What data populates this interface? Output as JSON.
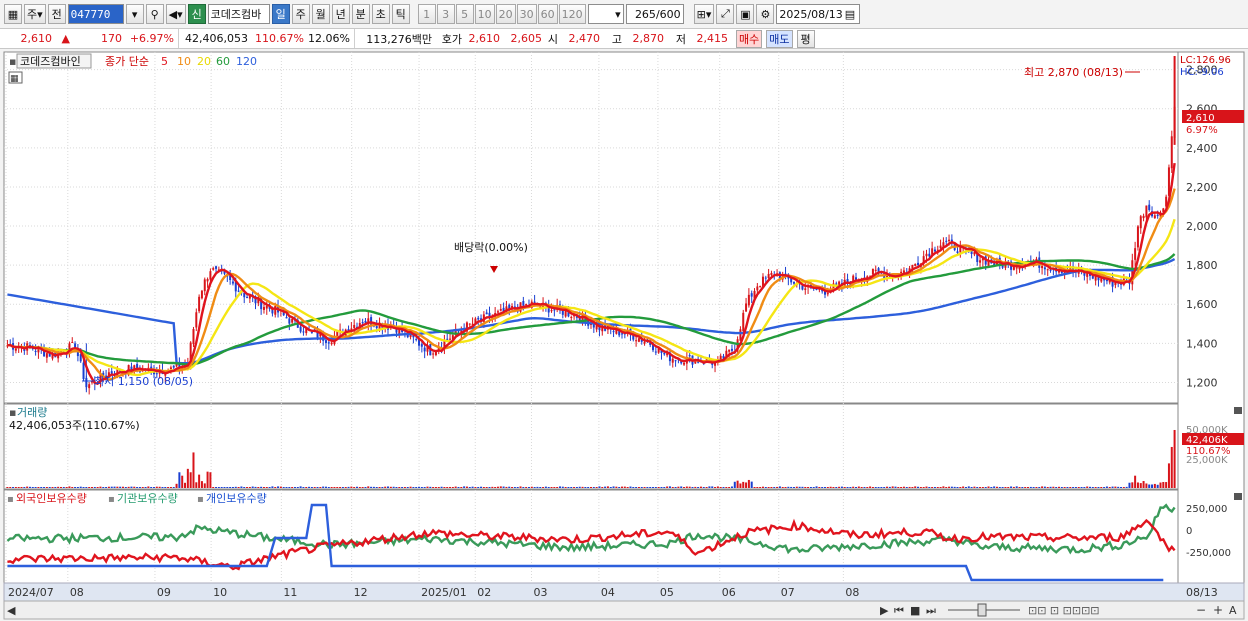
{
  "toolbar": {
    "market": "주",
    "prev": "전",
    "code": "047770",
    "badge": "신",
    "name": "코데즈컴바",
    "periods": [
      "일",
      "주",
      "월",
      "년",
      "분",
      "초",
      "틱"
    ],
    "intervals": [
      "1",
      "3",
      "5",
      "10",
      "20",
      "30",
      "60",
      "120"
    ],
    "count": "265",
    "count_total": "/600",
    "date": "2025/08/13"
  },
  "quote": {
    "price": "2,610",
    "arrow": "▲",
    "change": "170",
    "change_pct": "+6.97%",
    "volume": "42,406,053",
    "volume_ratio": "110.67%",
    "turnover": "12.06%",
    "amount": "113,276백만",
    "ask_label": "호가",
    "ask1": "2,610",
    "ask2": "2,605",
    "open_label": "시",
    "open": "2,470",
    "high_label": "고",
    "high": "2,870",
    "low_label": "저",
    "low": "2,415",
    "buy_label": "매수",
    "sell_label": "매도",
    "avg_label": "평"
  },
  "legend": {
    "stock": "코데즈컴바인",
    "ma_label": "종가 단순",
    "ma5": "5",
    "ma10": "10",
    "ma20": "20",
    "ma60": "60",
    "ma120": "120"
  },
  "annotations": {
    "high": "최고 2,870 (08/13)",
    "low": "최저 1,150 (08/05)",
    "dividend": "배당락(0.00%)",
    "lc": "LC:126.96",
    "hc": "HC:-9.06",
    "last_price": "2,610",
    "last_pct": "6.97%",
    "vol_title": "거래량",
    "vol_value": "42,406,053주(110.67%)",
    "vol_last": "42,406K",
    "vol_pct": "110.67%",
    "holders": [
      "외국인보유수량",
      "기관보유수량",
      "개인보유수량"
    ]
  },
  "x_labels": [
    "2024/07",
    "08",
    "09",
    "10",
    "11",
    "12",
    "2025/01",
    "02",
    "03",
    "04",
    "05",
    "06",
    "07",
    "08",
    "08/13"
  ],
  "y_labels": [
    "2,800",
    "2,600",
    "2,400",
    "2,200",
    "2,000",
    "1,800",
    "1,600",
    "1,400",
    "1,200"
  ],
  "vol_y_labels": [
    "50,000K",
    "25,000K"
  ],
  "hold_y_labels": [
    "250,000",
    "0",
    "-250,000"
  ],
  "colors": {
    "ma5": "#e0141e",
    "ma10": "#f08c14",
    "ma20": "#f5e614",
    "ma60": "#239b3c",
    "ma120": "#2d5fdc",
    "up": "#d8141a",
    "down": "#1a3fd1"
  },
  "chart_data": {
    "type": "candlestick",
    "title": "코데즈컴바인",
    "ylim": [
      1100,
      2880
    ],
    "price_path": [
      [
        0,
        1390
      ],
      [
        8,
        1380
      ],
      [
        16,
        1340
      ],
      [
        24,
        1390
      ],
      [
        28,
        1180
      ],
      [
        36,
        1250
      ],
      [
        44,
        1270
      ],
      [
        52,
        1260
      ],
      [
        60,
        1270
      ],
      [
        64,
        1300
      ],
      [
        68,
        1650
      ],
      [
        72,
        1780
      ],
      [
        78,
        1730
      ],
      [
        84,
        1650
      ],
      [
        90,
        1600
      ],
      [
        96,
        1560
      ],
      [
        102,
        1500
      ],
      [
        108,
        1450
      ],
      [
        114,
        1420
      ],
      [
        120,
        1470
      ],
      [
        126,
        1520
      ],
      [
        132,
        1500
      ],
      [
        138,
        1480
      ],
      [
        144,
        1420
      ],
      [
        150,
        1360
      ],
      [
        156,
        1420
      ],
      [
        162,
        1480
      ],
      [
        168,
        1520
      ],
      [
        174,
        1550
      ],
      [
        180,
        1580
      ],
      [
        186,
        1600
      ],
      [
        192,
        1580
      ],
      [
        198,
        1560
      ],
      [
        204,
        1530
      ],
      [
        210,
        1480
      ],
      [
        216,
        1460
      ],
      [
        222,
        1440
      ],
      [
        228,
        1400
      ],
      [
        234,
        1330
      ],
      [
        240,
        1320
      ],
      [
        246,
        1310
      ],
      [
        252,
        1300
      ],
      [
        258,
        1380
      ],
      [
        262,
        1600
      ],
      [
        266,
        1700
      ],
      [
        272,
        1760
      ],
      [
        278,
        1720
      ],
      [
        284,
        1680
      ],
      [
        290,
        1670
      ],
      [
        296,
        1700
      ],
      [
        302,
        1740
      ],
      [
        308,
        1760
      ],
      [
        314,
        1750
      ],
      [
        320,
        1780
      ],
      [
        326,
        1860
      ],
      [
        332,
        1920
      ],
      [
        338,
        1880
      ],
      [
        344,
        1840
      ],
      [
        350,
        1810
      ],
      [
        356,
        1800
      ],
      [
        362,
        1820
      ],
      [
        368,
        1800
      ],
      [
        374,
        1780
      ],
      [
        380,
        1760
      ],
      [
        386,
        1740
      ],
      [
        392,
        1710
      ],
      [
        398,
        1720
      ],
      [
        401,
        2000
      ],
      [
        404,
        2110
      ],
      [
        408,
        2040
      ],
      [
        411,
        2150
      ],
      [
        414,
        2610
      ]
    ],
    "series": [
      {
        "name": "5",
        "values": []
      },
      {
        "name": "10",
        "values": []
      },
      {
        "name": "20",
        "values": []
      },
      {
        "name": "60",
        "values": []
      },
      {
        "name": "120",
        "values": []
      }
    ]
  }
}
